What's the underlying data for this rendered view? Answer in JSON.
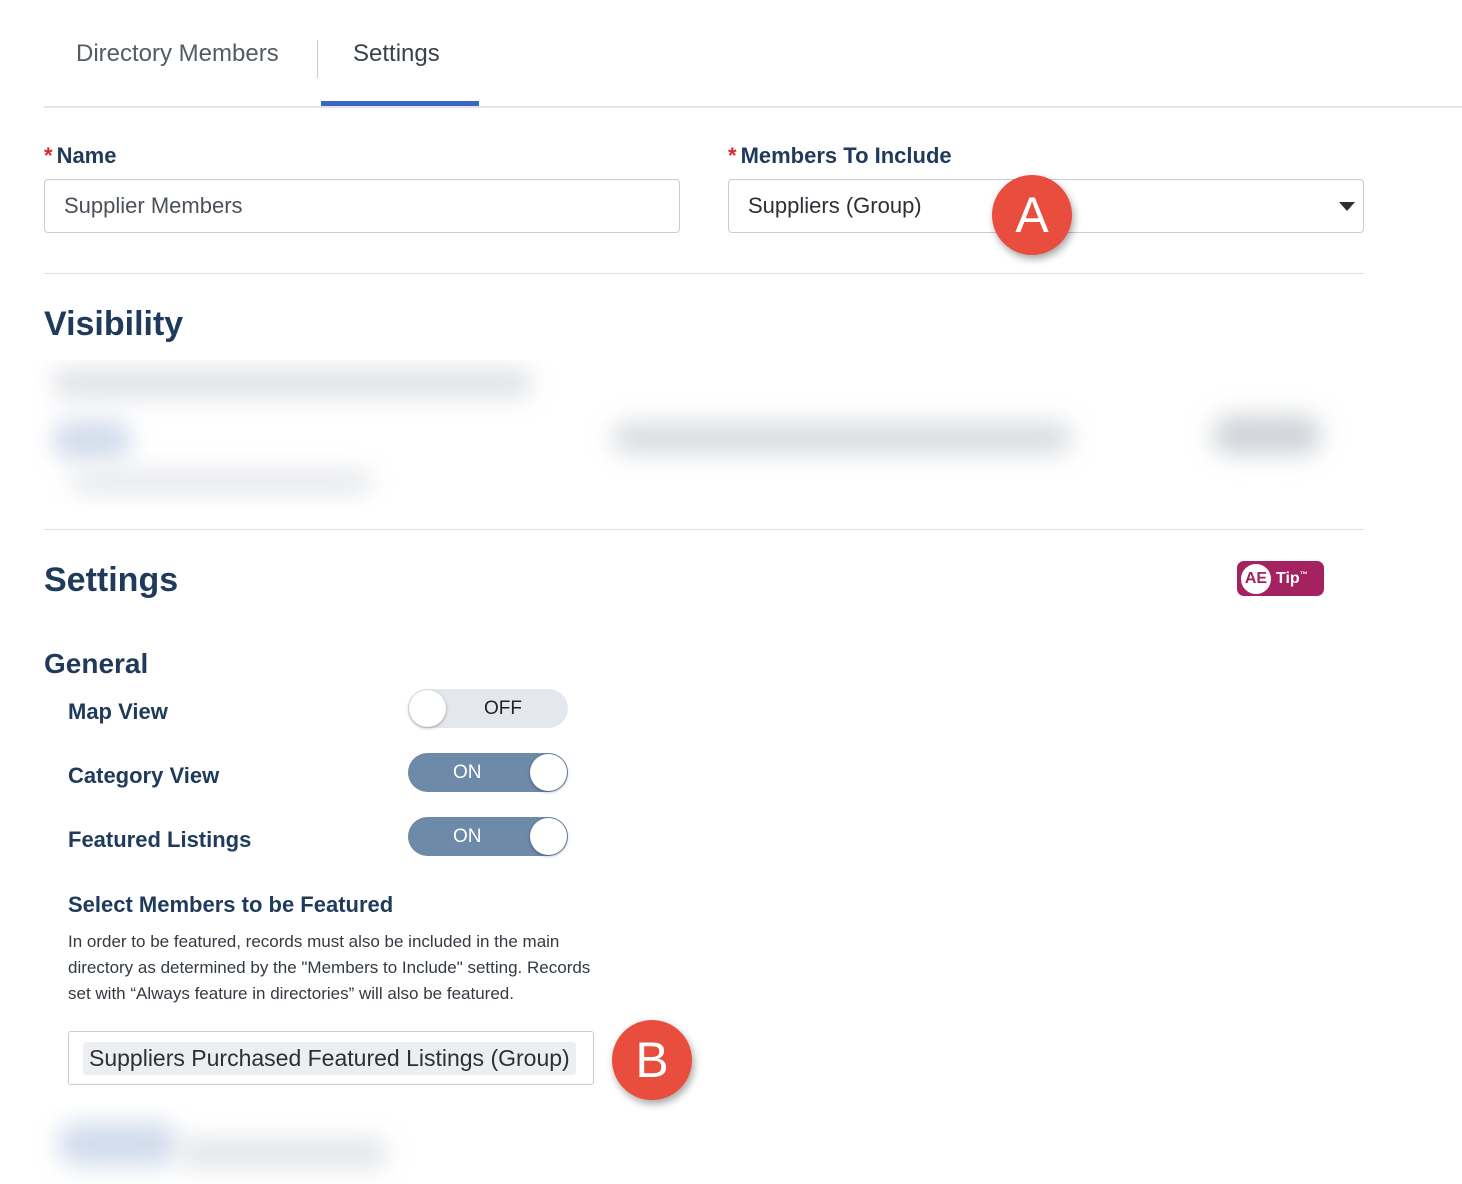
{
  "tabs": [
    {
      "label": "Directory Members",
      "active": false
    },
    {
      "label": "Settings",
      "active": true
    }
  ],
  "form": {
    "name_label": "Name",
    "name_value": "Supplier Members",
    "members_label": "Members To Include",
    "members_value": "Suppliers (Group)",
    "required_mark": "*"
  },
  "sections": {
    "visibility": "Visibility",
    "settings": "Settings",
    "general": "General"
  },
  "ae_tip": {
    "circle": "AE",
    "text": "Tip",
    "tm": "™"
  },
  "toggles": [
    {
      "label": "Map View",
      "state": "OFF"
    },
    {
      "label": "Category View",
      "state": "ON"
    },
    {
      "label": "Featured Listings",
      "state": "ON"
    }
  ],
  "featured": {
    "title": "Select Members to be Featured",
    "help": "In order to be featured, records must also be included in the main directory as determined by the \"Members to Include\" setting. Records set with “Always feature in directories” will also be featured.",
    "tag": "Suppliers Purchased Featured Listings (Group)"
  },
  "markers": {
    "a": "A",
    "b": "B"
  },
  "colors": {
    "accent": "#3a66c8",
    "heading": "#1f3a5a",
    "required": "#d9262c",
    "toggle_on": "#6d8aa8",
    "ae_tip": "#a3225f",
    "marker": "#e84d3d"
  }
}
